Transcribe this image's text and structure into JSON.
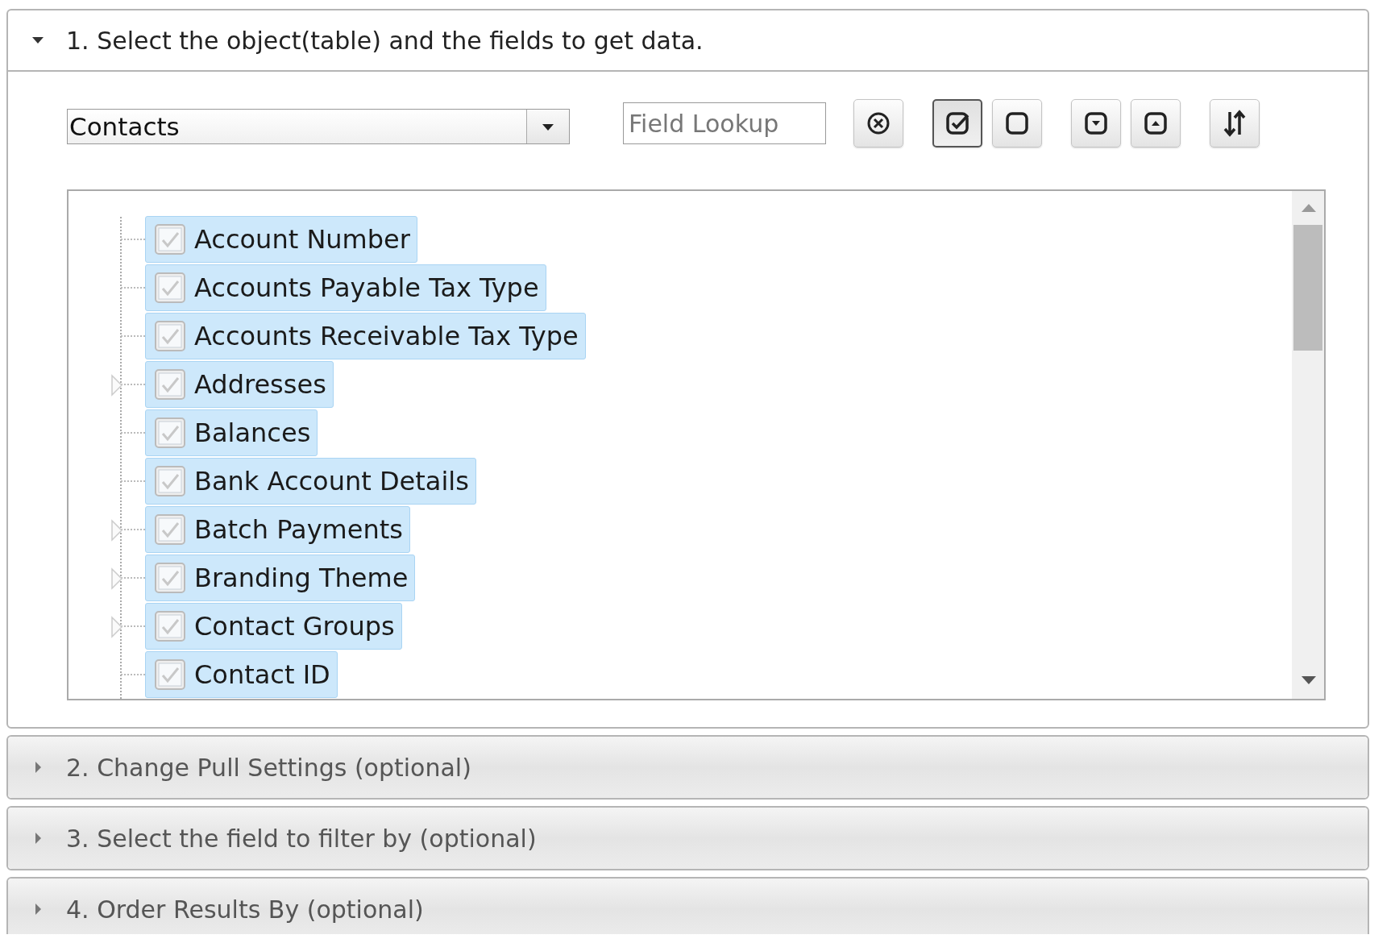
{
  "sections": [
    {
      "title": "1. Select the object(table) and the fields to get data.",
      "expanded": true
    },
    {
      "title": "2. Change Pull Settings (optional)",
      "expanded": false
    },
    {
      "title": "3. Select the field to filter by (optional)",
      "expanded": false
    },
    {
      "title": "4. Order Results By (optional)",
      "expanded": false
    }
  ],
  "object_select": {
    "value": "Contacts"
  },
  "field_lookup": {
    "placeholder": "Field Lookup"
  },
  "toolbar": [
    {
      "kind": "clear",
      "pressed": false
    },
    {
      "kind": "check-all",
      "pressed": true
    },
    {
      "kind": "uncheck-all",
      "pressed": false
    },
    {
      "kind": "expand-all",
      "pressed": false
    },
    {
      "kind": "collapse-all",
      "pressed": false
    },
    {
      "kind": "sort",
      "pressed": false
    }
  ],
  "fields": [
    {
      "label": "Account Number",
      "checked": true,
      "expandable": false
    },
    {
      "label": "Accounts Payable Tax Type",
      "checked": true,
      "expandable": false
    },
    {
      "label": "Accounts Receivable Tax Type",
      "checked": true,
      "expandable": false
    },
    {
      "label": "Addresses",
      "checked": true,
      "expandable": true
    },
    {
      "label": "Balances",
      "checked": true,
      "expandable": false
    },
    {
      "label": "Bank Account Details",
      "checked": true,
      "expandable": false
    },
    {
      "label": "Batch Payments",
      "checked": true,
      "expandable": true
    },
    {
      "label": "Branding Theme",
      "checked": true,
      "expandable": true
    },
    {
      "label": "Contact Groups",
      "checked": true,
      "expandable": true
    },
    {
      "label": "Contact ID",
      "checked": true,
      "expandable": false
    }
  ]
}
